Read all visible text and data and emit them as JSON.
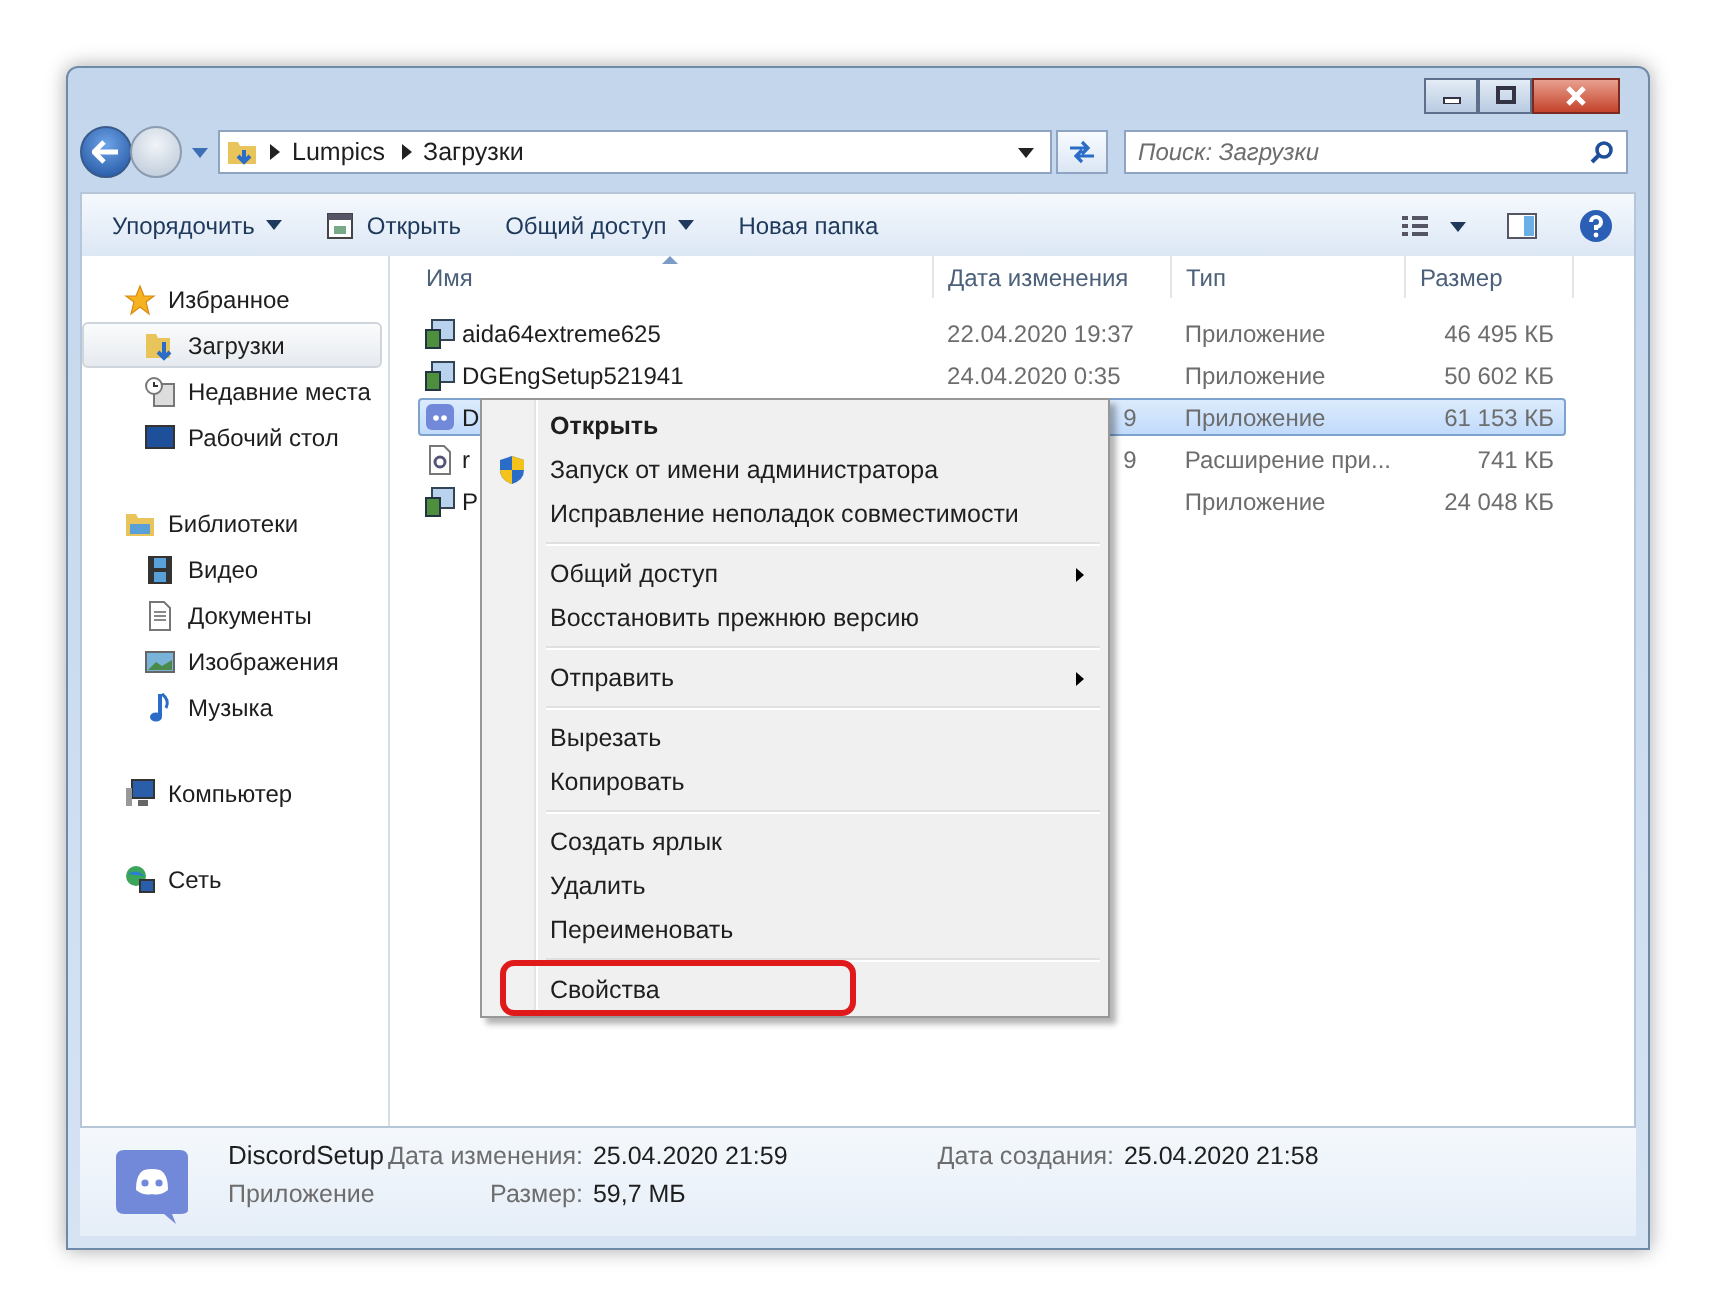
{
  "address": {
    "path": [
      "Lumpics",
      "Загрузки"
    ]
  },
  "search": {
    "placeholder": "Поиск: Загрузки"
  },
  "toolbar": [
    {
      "label": "Упорядочить",
      "kind": "dropdown"
    },
    {
      "label": "Открыть",
      "kind": "open"
    },
    {
      "label": "Общий доступ",
      "kind": "dropdown"
    },
    {
      "label": "Новая папка",
      "kind": "plain"
    }
  ],
  "sidebar": [
    {
      "label": "Избранное",
      "kind": "star",
      "children": [
        {
          "label": "Загрузки",
          "kind": "downloads",
          "selected": true
        },
        {
          "label": "Недавние места",
          "kind": "recent",
          "selected": false
        },
        {
          "label": "Рабочий стол",
          "kind": "desktop",
          "selected": false
        }
      ]
    },
    {
      "label": "Библиотеки",
      "kind": "library",
      "children": [
        {
          "label": "Видео",
          "kind": "video",
          "selected": false
        },
        {
          "label": "Документы",
          "kind": "document",
          "selected": false
        },
        {
          "label": "Изображения",
          "kind": "image",
          "selected": false
        },
        {
          "label": "Музыка",
          "kind": "music",
          "selected": false
        }
      ]
    },
    {
      "label": "Компьютер",
      "kind": "computer"
    },
    {
      "label": "Сеть",
      "kind": "network"
    }
  ],
  "columns": [
    {
      "label": "Имя",
      "sorted": true
    },
    {
      "label": "Дата изменения",
      "sorted": false
    },
    {
      "label": "Тип",
      "sorted": false
    },
    {
      "label": "Размер",
      "sorted": false
    }
  ],
  "rows": [
    {
      "name": "aida64extreme625",
      "date": "22.04.2020 19:37",
      "type": "Приложение",
      "size": "46 495 КБ",
      "kind": "installer",
      "selected": false,
      "covered": false
    },
    {
      "name": "DGEngSetup521941",
      "date": "24.04.2020 0:35",
      "type": "Приложение",
      "size": "50 602 КБ",
      "kind": "installer",
      "selected": false,
      "covered": false
    },
    {
      "name": "D",
      "date": "9",
      "type": "Приложение",
      "size": "61 153 КБ",
      "kind": "discord",
      "selected": true,
      "covered": true
    },
    {
      "name": "r",
      "date": "9",
      "type": "Расширение при...",
      "size": "741 КБ",
      "kind": "extension",
      "selected": false,
      "covered": true
    },
    {
      "name": "P",
      "type": "Приложение",
      "size": "24 048 КБ",
      "kind": "installer",
      "selected": false,
      "covered": true
    }
  ],
  "context_menu": [
    {
      "kind": "item",
      "label": "Открыть",
      "default": true,
      "submenu": false,
      "elevated": false,
      "highlighted": false
    },
    {
      "kind": "item",
      "label": "Запуск от имени администратора",
      "default": false,
      "submenu": false,
      "elevated": true,
      "highlighted": false
    },
    {
      "kind": "item",
      "label": "Исправление неполадок совместимости",
      "default": false,
      "submenu": false,
      "elevated": false,
      "highlighted": false
    },
    {
      "kind": "separator"
    },
    {
      "kind": "item",
      "label": "Общий доступ",
      "default": false,
      "submenu": true,
      "elevated": false,
      "highlighted": false
    },
    {
      "kind": "item",
      "label": "Восстановить прежнюю версию",
      "default": false,
      "submenu": false,
      "elevated": false,
      "highlighted": false
    },
    {
      "kind": "separator"
    },
    {
      "kind": "item",
      "label": "Отправить",
      "default": false,
      "submenu": true,
      "elevated": false,
      "highlighted": false
    },
    {
      "kind": "separator"
    },
    {
      "kind": "item",
      "label": "Вырезать",
      "default": false,
      "submenu": false,
      "elevated": false,
      "highlighted": false
    },
    {
      "kind": "item",
      "label": "Копировать",
      "default": false,
      "submenu": false,
      "elevated": false,
      "highlighted": false
    },
    {
      "kind": "separator"
    },
    {
      "kind": "item",
      "label": "Создать ярлык",
      "default": false,
      "submenu": false,
      "elevated": false,
      "highlighted": false
    },
    {
      "kind": "item",
      "label": "Удалить",
      "default": false,
      "submenu": false,
      "elevated": false,
      "highlighted": false
    },
    {
      "kind": "item",
      "label": "Переименовать",
      "default": false,
      "submenu": false,
      "elevated": false,
      "highlighted": false
    },
    {
      "kind": "separator"
    },
    {
      "kind": "item",
      "label": "Свойства",
      "default": false,
      "submenu": false,
      "elevated": false,
      "highlighted": true
    }
  ],
  "details": {
    "name": "DiscordSetup",
    "type": "Приложение",
    "fields": [
      {
        "label": "Дата изменения:",
        "value": "25.04.2020 21:59"
      },
      {
        "label": "Размер:",
        "value": "59,7 МБ"
      },
      {
        "label": "Дата создания:",
        "value": "25.04.2020 21:58"
      }
    ]
  }
}
